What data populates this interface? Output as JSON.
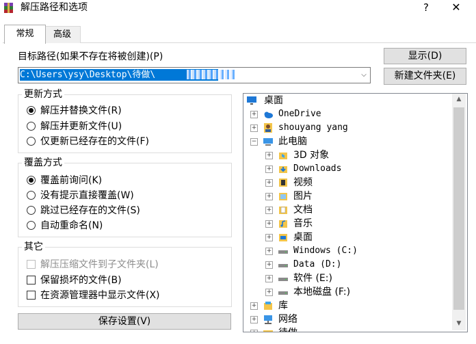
{
  "window": {
    "title": "解压路径和选项",
    "help_glyph": "?",
    "close_glyph": "✕"
  },
  "tabs": [
    {
      "label": "常规",
      "selected": true
    },
    {
      "label": "高级",
      "selected": false
    }
  ],
  "path": {
    "label": "目标路径(如果不存在将被创建)(P)",
    "value": "C:\\Users\\ysy\\Desktop\\待做\\",
    "dropdown_glyph": "⌵"
  },
  "buttons": {
    "show": "显示(D)",
    "new_folder": "新建文件夹(E)",
    "save": "保存设置(V)"
  },
  "update_mode": {
    "title": "更新方式",
    "options": [
      {
        "label": "解压并替换文件(R)",
        "selected": true
      },
      {
        "label": "解压并更新文件(U)",
        "selected": false
      },
      {
        "label": "仅更新已经存在的文件(F)",
        "selected": false
      }
    ]
  },
  "overwrite_mode": {
    "title": "覆盖方式",
    "options": [
      {
        "label": "覆盖前询问(K)",
        "selected": true
      },
      {
        "label": "没有提示直接覆盖(W)",
        "selected": false
      },
      {
        "label": "跳过已经存在的文件(S)",
        "selected": false
      },
      {
        "label": "自动重命名(N)",
        "selected": false
      }
    ]
  },
  "misc": {
    "title": "其它",
    "options": [
      {
        "label": "解压压缩文件到子文件夹(L)",
        "checked": false,
        "disabled": true
      },
      {
        "label": "保留损坏的文件(B)",
        "checked": false,
        "disabled": false
      },
      {
        "label": "在资源管理器中显示文件(X)",
        "checked": false,
        "disabled": false
      }
    ]
  },
  "tree": {
    "items": [
      {
        "label": "桌面",
        "icon": "desktop-icon"
      },
      {
        "label": "OneDrive",
        "icon": "cloud-icon"
      },
      {
        "label": "shouyang yang",
        "icon": "user-icon"
      },
      {
        "label": "此电脑",
        "icon": "computer-icon"
      },
      {
        "label": "3D 对象",
        "icon": "3d-objects-icon"
      },
      {
        "label": "Downloads",
        "icon": "downloads-icon"
      },
      {
        "label": "视频",
        "icon": "video-icon"
      },
      {
        "label": "图片",
        "icon": "pictures-icon"
      },
      {
        "label": "文档",
        "icon": "documents-icon"
      },
      {
        "label": "音乐",
        "icon": "music-icon"
      },
      {
        "label": "桌面",
        "icon": "desktop-folder-icon"
      },
      {
        "label": "Windows (C:)",
        "icon": "drive-icon"
      },
      {
        "label": "Data (D:)",
        "icon": "drive-icon"
      },
      {
        "label": "软件 (E:)",
        "icon": "drive-icon"
      },
      {
        "label": "本地磁盘 (F:)",
        "icon": "drive-icon"
      },
      {
        "label": "库",
        "icon": "library-icon"
      },
      {
        "label": "网络",
        "icon": "network-icon"
      },
      {
        "label": "待做",
        "icon": "folder-icon"
      }
    ]
  },
  "colors": {
    "selection": "#0078d7",
    "folder": "#f3c54a",
    "drive": "#8a8a8a",
    "accent": "#1e78d6"
  }
}
